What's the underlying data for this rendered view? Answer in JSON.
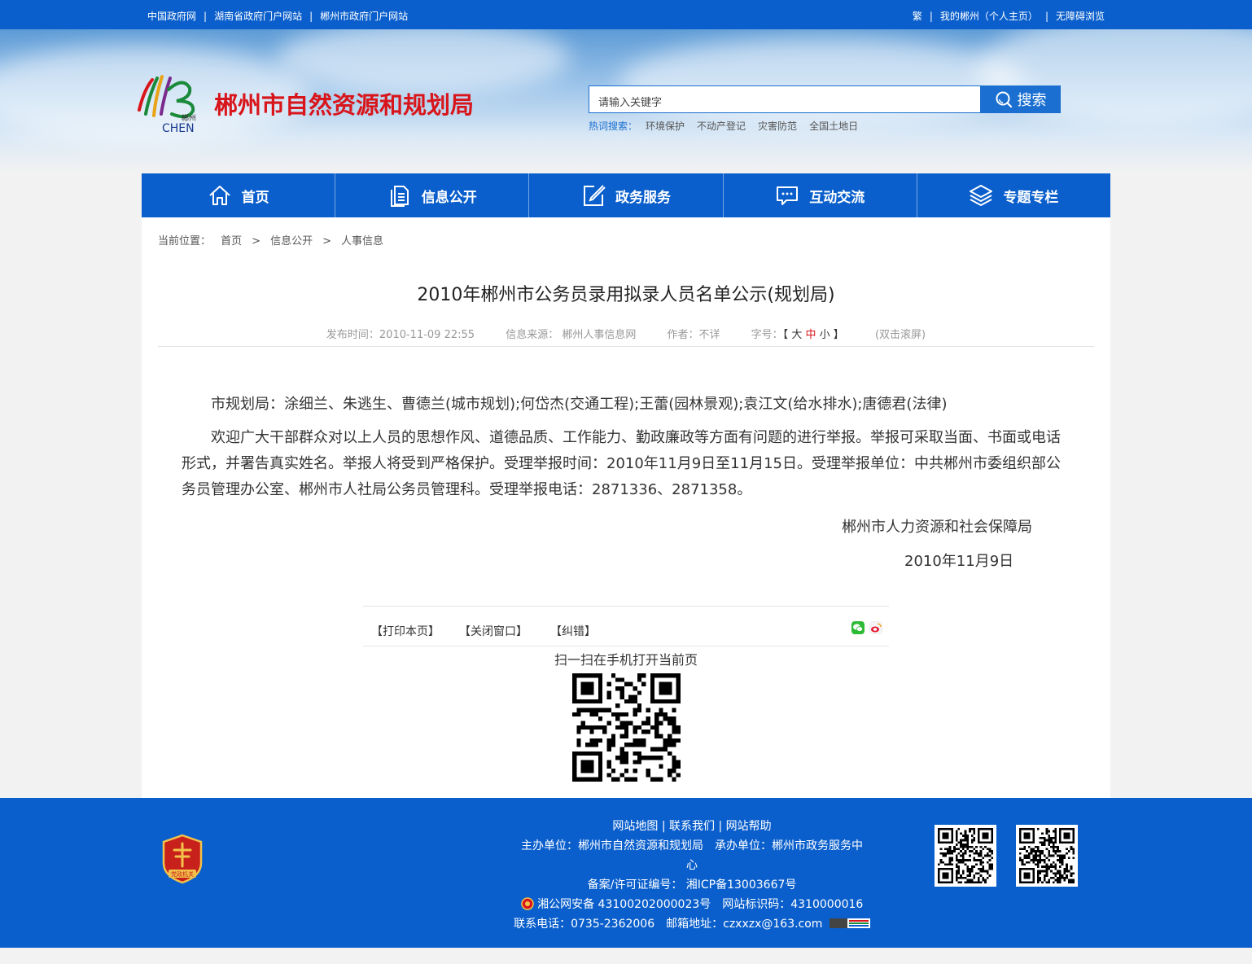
{
  "topbar": {
    "left_links": [
      "中国政府网",
      "湖南省政府门户网站",
      "郴州市政府门户网站"
    ],
    "right_links": [
      "繁",
      "我的郴州（个人主页）",
      "无障碍浏览"
    ]
  },
  "header": {
    "logo_caption": "郴州",
    "logo_text": "CHEN",
    "site_title": "郴州市自然资源和规划局",
    "search_placeholder": "请输入关键字",
    "search_button": "搜索",
    "hot_label": "热词搜索：",
    "hot_words": [
      "环境保护",
      "不动产登记",
      "灾害防范",
      "全国土地日"
    ]
  },
  "nav": {
    "items": [
      {
        "label": "首页",
        "icon": "home-icon"
      },
      {
        "label": "信息公开",
        "icon": "document-icon"
      },
      {
        "label": "政务服务",
        "icon": "edit-icon"
      },
      {
        "label": "互动交流",
        "icon": "chat-icon"
      },
      {
        "label": "专题专栏",
        "icon": "layers-icon"
      }
    ]
  },
  "breadcrumb": {
    "prefix": "当前位置：",
    "items": [
      "首页",
      "信息公开",
      "人事信息"
    ],
    "separator": ">"
  },
  "article": {
    "title": "2010年郴州市公务员录用拟录人员名单公示(规划局)",
    "meta": {
      "publish_time": "发布时间：2010-11-09 22:55",
      "source": "信息来源： 郴州人事信息网",
      "author": "作者：不详",
      "font_label": "字号：",
      "font_open": "【",
      "font_large": "大",
      "font_medium": "中",
      "font_small": "小",
      "font_close": "】",
      "scroll": "(双击滚屏)"
    },
    "paragraphs": [
      "市规划局：涂细兰、朱逃生、曹德兰(城市规划);何岱杰(交通工程);王蕾(园林景观);袁江文(给水排水);唐德君(法律)",
      "欢迎广大干部群众对以上人员的思想作风、道德品质、工作能力、勤政廉政等方面有问题的进行举报。举报可采取当面、书面或电话形式，并署告真实姓名。举报人将受到严格保护。受理举报时间：2010年11月9日至11月15日。受理举报单位：中共郴州市委组织部公务员管理办公室、郴州市人社局公务员管理科。受理举报电话：2871336、2871358。"
    ],
    "signature_org": "郴州市人力资源和社会保障局",
    "signature_date": "2010年11月9日"
  },
  "tools": {
    "print": "【打印本页】",
    "close": "【关闭窗口】",
    "error": "【纠错】",
    "scan_text": "扫一扫在手机打开当前页"
  },
  "footer": {
    "links": [
      "网站地图",
      "联系我们",
      "网站帮助"
    ],
    "sponsor": "主办单位：郴州市自然资源和规划局　承办单位：郴州市政务服务中",
    "sponsor_wrap": "心",
    "icp": "备案/许可证编号： 湘ICP备13003667号",
    "police": "湘公网安备 43100202000023号",
    "site_id": "网站标识码：4310000016",
    "contact": "联系电话：0735-2362006　邮箱地址：czxxzx@163.com",
    "badge_text": "党政机关"
  },
  "colors": {
    "primary_blue": "#0a5fcc",
    "title_red": "#d8151b"
  }
}
